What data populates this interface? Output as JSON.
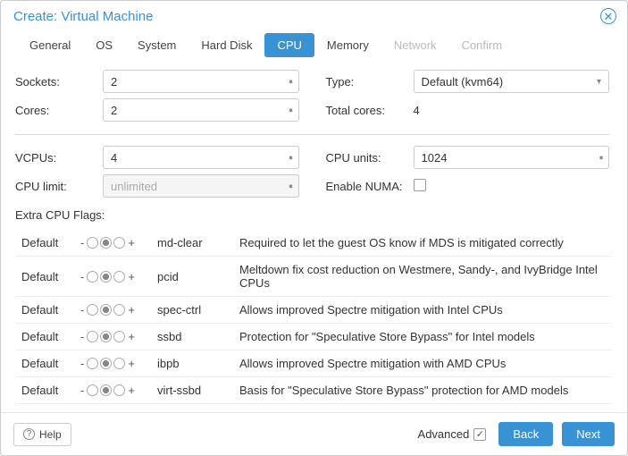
{
  "title": "Create: Virtual Machine",
  "tabs": [
    "General",
    "OS",
    "System",
    "Hard Disk",
    "CPU",
    "Memory",
    "Network",
    "Confirm"
  ],
  "active_tab": "CPU",
  "disabled_tabs": [
    "Network",
    "Confirm"
  ],
  "form": {
    "sockets_label": "Sockets:",
    "sockets": "2",
    "type_label": "Type:",
    "type": "Default (kvm64)",
    "cores_label": "Cores:",
    "cores": "2",
    "total_cores_label": "Total cores:",
    "total_cores": "4",
    "vcpus_label": "VCPUs:",
    "vcpus": "4",
    "cpu_units_label": "CPU units:",
    "cpu_units": "1024",
    "cpu_limit_label": "CPU limit:",
    "cpu_limit": "unlimited",
    "numa_label": "Enable NUMA:",
    "numa_checked": false
  },
  "flags_label": "Extra CPU Flags:",
  "flag_default_label": "Default",
  "flags": [
    {
      "name": "md-clear",
      "desc": "Required to let the guest OS know if MDS is mitigated correctly"
    },
    {
      "name": "pcid",
      "desc": "Meltdown fix cost reduction on Westmere, Sandy-, and IvyBridge Intel CPUs"
    },
    {
      "name": "spec-ctrl",
      "desc": "Allows improved Spectre mitigation with Intel CPUs"
    },
    {
      "name": "ssbd",
      "desc": "Protection for \"Speculative Store Bypass\" for Intel models"
    },
    {
      "name": "ibpb",
      "desc": "Allows improved Spectre mitigation with AMD CPUs"
    },
    {
      "name": "virt-ssbd",
      "desc": "Basis for \"Speculative Store Bypass\" protection for AMD models"
    }
  ],
  "footer": {
    "help": "Help",
    "advanced": "Advanced",
    "advanced_checked": true,
    "back": "Back",
    "next": "Next"
  }
}
